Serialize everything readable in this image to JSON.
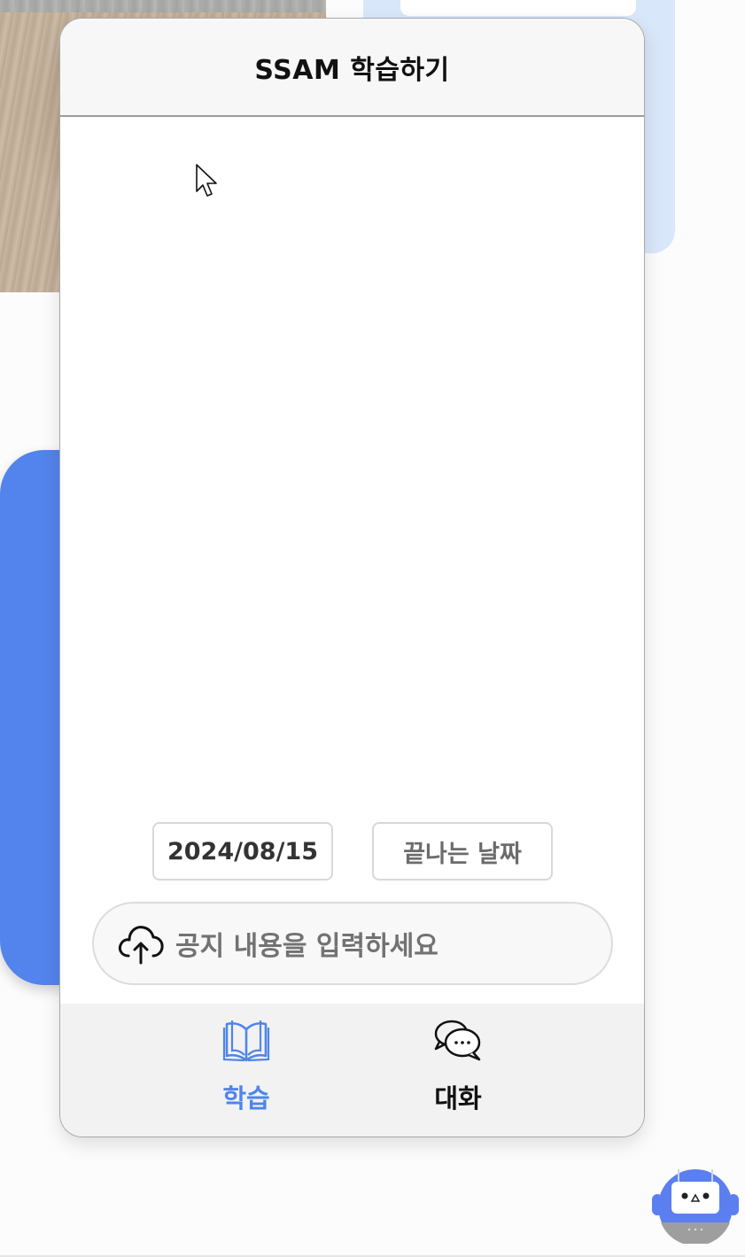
{
  "app": {
    "title": "SSAM 학습하기"
  },
  "dates": {
    "start_value": "2024/08/15",
    "end_placeholder": "끝나는 날짜"
  },
  "notice": {
    "placeholder": "공지 내용을 입력하세요",
    "icon": "cloud-upload-icon"
  },
  "tabs": [
    {
      "label": "학습",
      "icon": "open-book-icon",
      "active": true
    },
    {
      "label": "대화",
      "icon": "chat-bubbles-icon",
      "active": false
    }
  ],
  "colors": {
    "accent": "#4f85ea",
    "background_card": "#d9e7fb",
    "bot": "#5b7ff0"
  },
  "chatbot": {
    "icon": "robot-icon"
  }
}
